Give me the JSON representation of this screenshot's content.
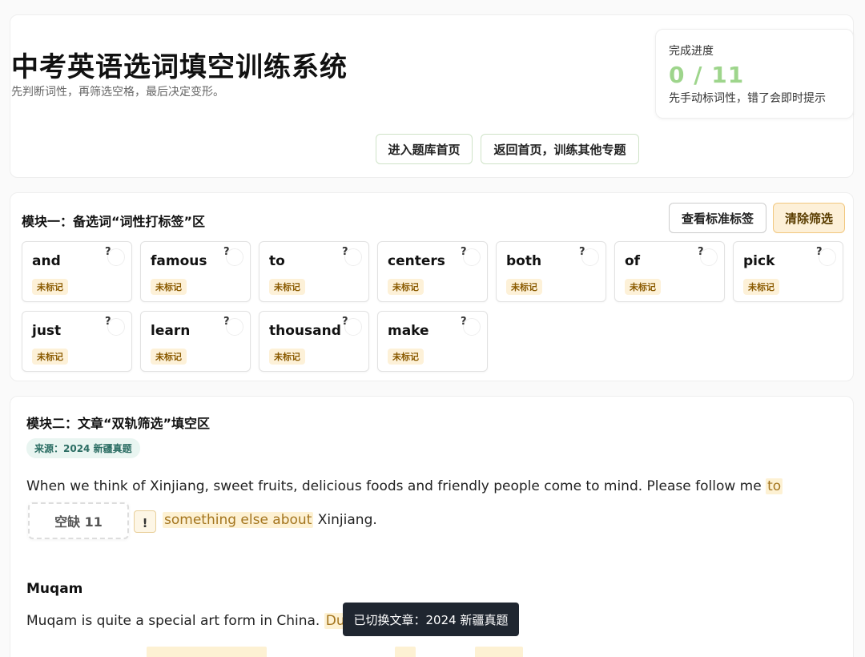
{
  "header": {
    "title": "中考英语选词填空训练系统",
    "subtitle": "先判断词性，再筛选空格，最后决定变形。",
    "buttons": {
      "bank_home": "进入题库首页",
      "back_home": "返回首页，训练其他专题"
    }
  },
  "progress": {
    "label": "完成进度",
    "value": "0 / 11",
    "hint": "先手动标词性，错了会即时提示"
  },
  "module1": {
    "title": "模块一：备选词“词性打标签”区",
    "buttons": {
      "standard": "查看标准标签",
      "clear": "清除筛选"
    },
    "tag_label": "未标记",
    "badge": "?",
    "words": [
      "and",
      "famous",
      "to",
      "centers",
      "both",
      "of",
      "pick",
      "just",
      "learn",
      "thousand",
      "make"
    ]
  },
  "module2": {
    "title": "模块二：文章“双轨筛选”填空区",
    "source": "来源：2024 新疆真题",
    "para1": {
      "text": "When we think of Xinjiang, sweet fruits, delicious foods and friendly people come to mind. Please follow me",
      "hl": "to"
    },
    "blank": "空缺 11",
    "excl": "!",
    "para2": {
      "hl": "something else about",
      "text": "Xinjiang."
    },
    "section": "Muqam",
    "para3": {
      "text": "Muqam is quite a special art form in China.",
      "hl": "Dur"
    }
  },
  "toast": "已切换文章：2024 新疆真题",
  "colors": {
    "progress": "#9ed58c",
    "highlight_bg": "#fdf1d3",
    "highlight_text": "#a4751e",
    "tag_bg": "#fdf1d8",
    "clear_bg": "#fdf0d8",
    "source_bg": "#e9f5f1",
    "toast_bg": "#1f2630"
  }
}
